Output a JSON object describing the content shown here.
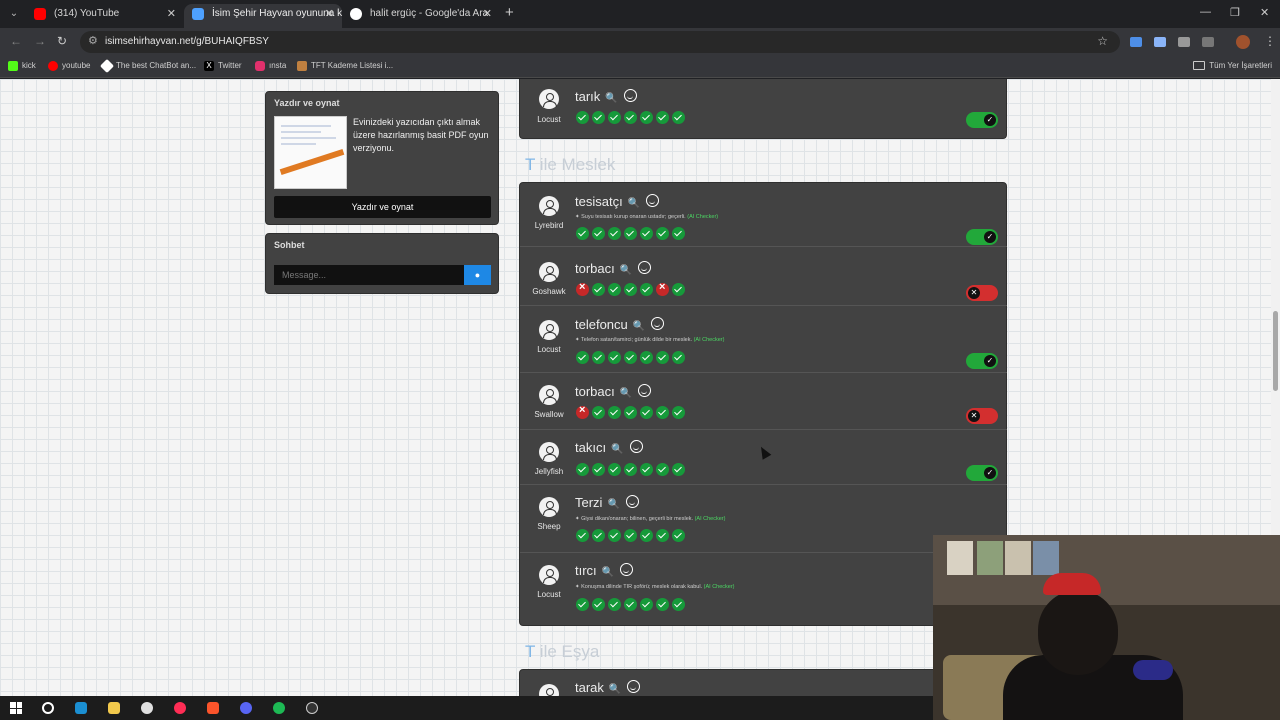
{
  "browser": {
    "tabs": [
      {
        "title": "(314) YouTube",
        "favicon_color": "#ff0000"
      },
      {
        "title": "İsim Şehir Hayvan oyununa kat",
        "favicon_color": "#4ea1ff"
      },
      {
        "title": "halit ergüç - Google'da Ara",
        "favicon_color": "#ffffff"
      }
    ],
    "url": "isimsehirhayvan.net/g/BUHAIQFBSY",
    "bookmarks": [
      {
        "label": "kick",
        "icon_color": "#53fc18"
      },
      {
        "label": "youtube",
        "icon_color": "#ff0000"
      },
      {
        "label": "The best ChatBot an...",
        "icon_color": "#ffffff"
      },
      {
        "label": "Twitter",
        "icon_color": "#000000"
      },
      {
        "label": "ınsta",
        "icon_color": "#e1306c"
      },
      {
        "label": "TFT Kademe Listesi i...",
        "icon_color": "#c08040"
      }
    ],
    "bookmarks_folder": "Tüm Yer İşaretleri"
  },
  "sidebar": {
    "print": {
      "title": "Yazdır ve oynat",
      "text": "Evinizdeki yazıcıdan çıktı almak üzere hazırlanmış basit PDF oyun verziyonu.",
      "button": "Yazdır ve oynat"
    },
    "chat": {
      "title": "Sohbet",
      "placeholder": "Message..."
    }
  },
  "top_entry": {
    "player": "Locust",
    "word": "tarık",
    "checks": [
      1,
      1,
      1,
      1,
      1,
      1,
      1
    ],
    "accepted": true
  },
  "sections": [
    {
      "letter": "T",
      "rest": " ile Meslek",
      "entries": [
        {
          "player": "Lyrebird",
          "word": "tesisatçı",
          "note": "Suyu tesisatı kurup onaran ustadır; geçerli.",
          "ai_tag": "(AI Checker)",
          "checks": [
            1,
            1,
            1,
            1,
            1,
            1,
            1
          ],
          "accepted": true
        },
        {
          "player": "Goshawk",
          "word": "torbacı",
          "note": "",
          "ai_tag": "",
          "checks": [
            0,
            1,
            1,
            1,
            1,
            0,
            1
          ],
          "accepted": false
        },
        {
          "player": "Locust",
          "word": "telefoncu",
          "note": "Telefon satan/tamirci; günlük dilde bir meslek.",
          "ai_tag": "(AI Checker)",
          "checks": [
            1,
            1,
            1,
            1,
            1,
            1,
            1
          ],
          "accepted": true
        },
        {
          "player": "Swallow",
          "word": "torbacı",
          "note": "",
          "ai_tag": "",
          "checks": [
            0,
            1,
            1,
            1,
            1,
            1,
            1
          ],
          "accepted": false
        },
        {
          "player": "Jellyfish",
          "word": "takıcı",
          "note": "",
          "ai_tag": "",
          "checks": [
            1,
            1,
            1,
            1,
            1,
            1,
            1
          ],
          "accepted": true
        },
        {
          "player": "Sheep",
          "word": "Terzi",
          "note": "Giysi dikan/onaran; bilinen, geçerli bir meslek.",
          "ai_tag": "(AI Checker)",
          "checks": [
            1,
            1,
            1,
            1,
            1,
            1,
            1
          ],
          "accepted": true
        },
        {
          "player": "Locust",
          "word": "tırcı",
          "note": "Konuşma dilinde TIR şoförü; meslek olarak kabul.",
          "ai_tag": "(AI Checker)",
          "checks": [
            1,
            1,
            1,
            1,
            1,
            1,
            1
          ],
          "accepted": true
        }
      ]
    },
    {
      "letter": "T",
      "rest": " ile Eşya",
      "entries": [
        {
          "player": "",
          "word": "tarak",
          "note": "",
          "ai_tag": "",
          "checks": [],
          "accepted": true
        }
      ]
    }
  ],
  "icons": {
    "search": "magnifier-icon",
    "emoji": "smile-icon",
    "cursor": "mouse-pointer"
  }
}
